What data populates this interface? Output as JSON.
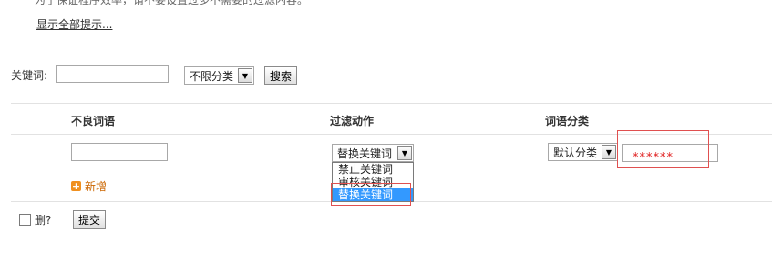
{
  "tips": {
    "truncated_text": "为了保证程序效率，请不要设置过多不需要的过滤内容。",
    "show_all_link": "显示全部提示..."
  },
  "search": {
    "keyword_label": "关键词:",
    "keyword_value": "",
    "category_selected": "不限分类",
    "search_button": "搜索"
  },
  "table": {
    "headers": [
      "不良词语",
      "过滤动作",
      "词语分类"
    ],
    "new_row": {
      "word_value": "",
      "action_selected": "替换关键词",
      "action_options": [
        "禁止关键词",
        "审核关键词",
        "替换关键词"
      ],
      "category_selected": "默认分类",
      "replacement_value": "******"
    },
    "add_label": "新增"
  },
  "footer": {
    "delete_label": "删?",
    "submit_button": "提交"
  },
  "colors": {
    "highlight_box": "#e05050",
    "selected_option": "#3399ff",
    "add_icon": "#f0901f",
    "replacement_text": "#e02020"
  },
  "icons": {
    "add": "plus-square-icon",
    "dropdown": "chevron-down-icon"
  }
}
